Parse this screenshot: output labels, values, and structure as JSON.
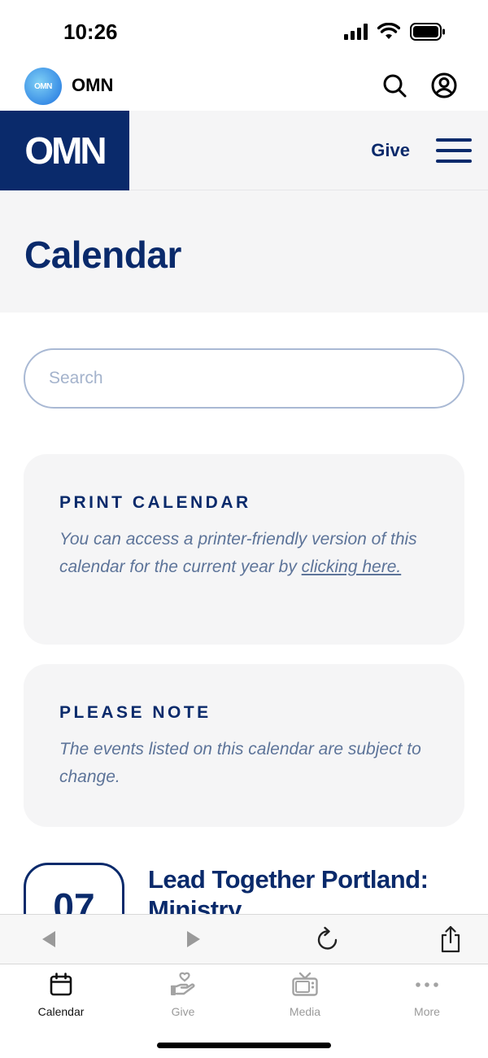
{
  "status_bar": {
    "time": "10:26"
  },
  "app_header": {
    "logo_text": "OMN",
    "app_name": "OMN"
  },
  "site_nav": {
    "logo_text": "OMN",
    "give_label": "Give"
  },
  "page": {
    "title": "Calendar"
  },
  "search": {
    "placeholder": "Search"
  },
  "print_card": {
    "heading": "PRINT CALENDAR",
    "body": "You can access a printer-friendly version of this calendar for the current year by ",
    "link": "clicking here."
  },
  "note_card": {
    "heading": "PLEASE NOTE",
    "body": "The events listed on this calendar are subject to change."
  },
  "event": {
    "day": "07",
    "title": "Lead Together Portland: Ministry"
  },
  "tab_bar": {
    "tabs": [
      {
        "label": "Calendar",
        "icon": "calendar-icon",
        "active": true
      },
      {
        "label": "Give",
        "icon": "give-hand-heart-icon",
        "active": false
      },
      {
        "label": "Media",
        "icon": "tv-icon",
        "active": false
      },
      {
        "label": "More",
        "icon": "more-dots-icon",
        "active": false
      }
    ]
  },
  "colors": {
    "brand_navy": "#0a2a6b",
    "muted_text": "#5d7499",
    "panel_bg": "#f5f5f6"
  }
}
